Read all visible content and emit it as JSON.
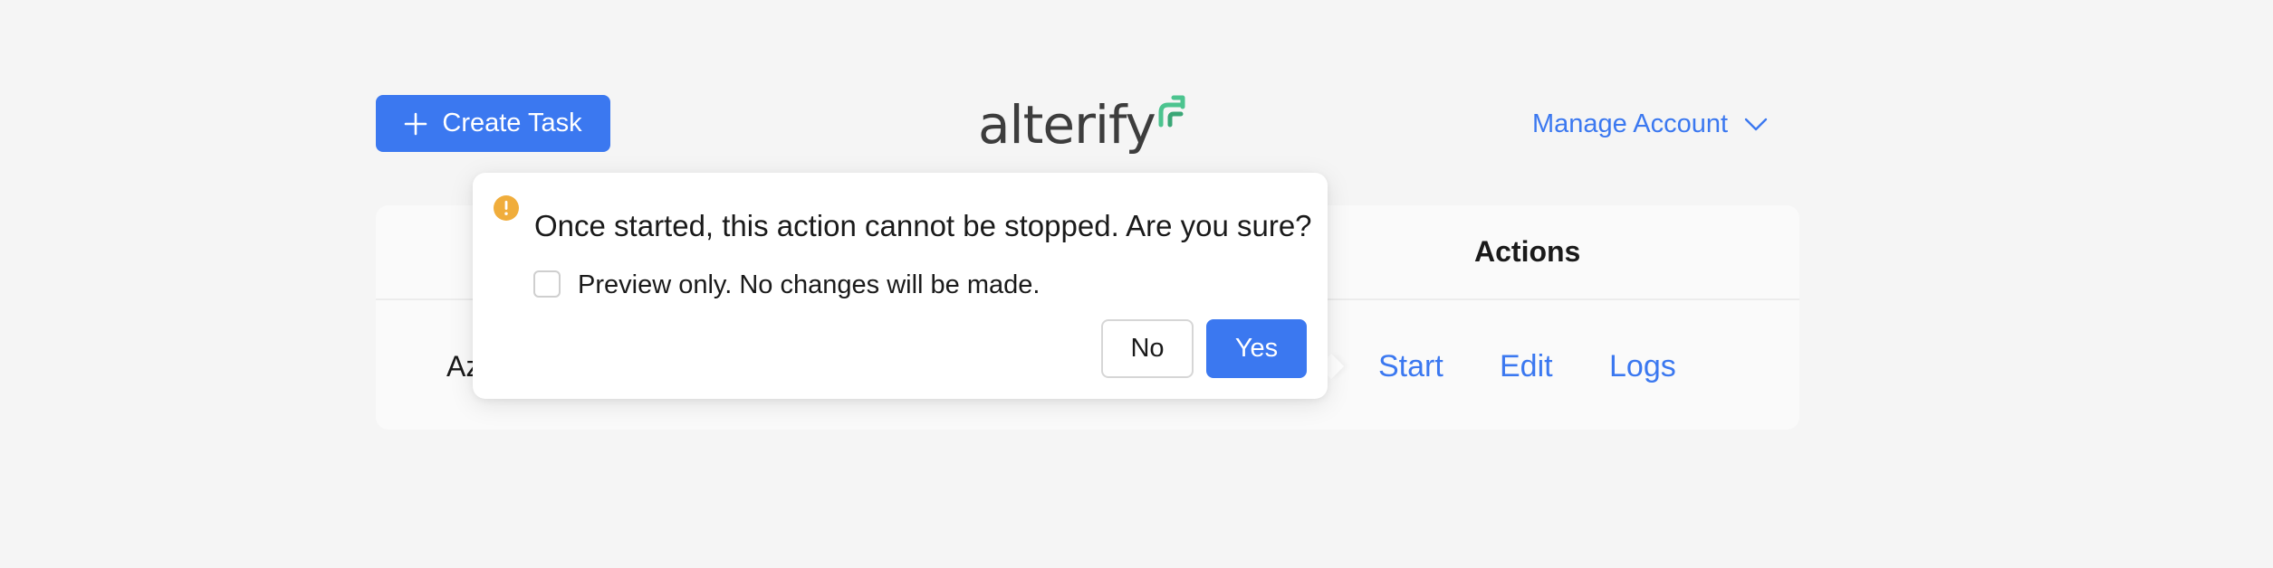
{
  "header": {
    "create_task_label": "Create Task",
    "logo_text": "alterify",
    "manage_account_label": "Manage Account"
  },
  "table": {
    "columns": [
      "Actions"
    ],
    "rows": [
      {
        "name": "Az",
        "actions": [
          "Start",
          "Edit",
          "Logs"
        ]
      }
    ]
  },
  "popconfirm": {
    "title": "Once started, this action cannot be stopped. Are you sure?",
    "checkbox_label": "Preview only. No changes will be made.",
    "checkbox_checked": false,
    "no_label": "No",
    "yes_label": "Yes"
  },
  "icons": {
    "create": "plus-icon",
    "manage_account": "chevron-down-icon",
    "warning": "exclamation-circle-icon",
    "logo": "logo-arrows-icon"
  },
  "colors": {
    "primary": "#3b78f0",
    "warning": "#f0ad3c",
    "logo_accent": "#4cc48f",
    "background": "#f5f5f5"
  }
}
